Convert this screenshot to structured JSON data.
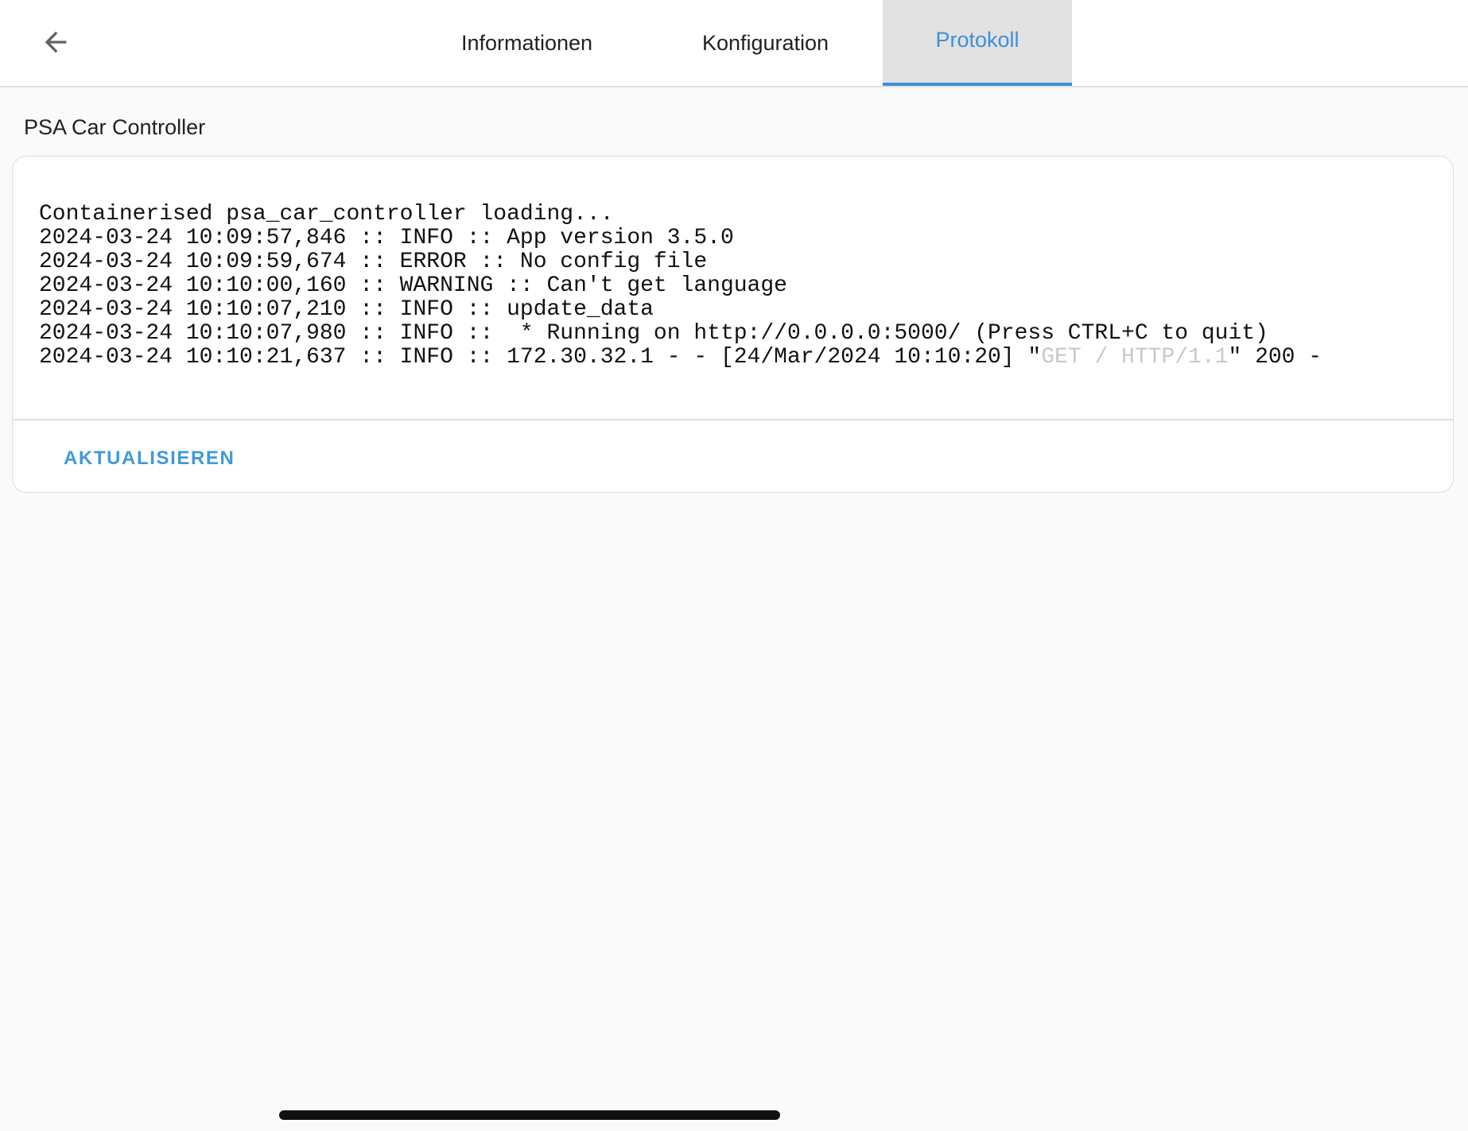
{
  "header": {
    "back_icon": "arrow-left-icon",
    "tabs": [
      {
        "label": "Informationen",
        "active": false
      },
      {
        "label": "Konfiguration",
        "active": false
      },
      {
        "label": "Protokoll",
        "active": true
      }
    ]
  },
  "addon": {
    "name": "PSA Car Controller"
  },
  "log": {
    "lines": [
      "Containerised psa_car_controller loading...",
      "2024-03-24 10:09:57,846 :: INFO :: App version 3.5.0",
      "2024-03-24 10:09:59,674 :: ERROR :: No config file",
      "2024-03-24 10:10:00,160 :: WARNING :: Can't get language",
      "2024-03-24 10:10:07,210 :: INFO :: update_data",
      "2024-03-24 10:10:07,980 :: INFO ::  * Running on http://0.0.0.0:5000/ (Press CTRL+C to quit)"
    ],
    "last_line": {
      "prefix": "2024-03-24 10:10:21,637 :: INFO :: 172.30.32.1 - - [24/Mar/2024 10:10:20] \"",
      "request": "GET / HTTP/1.1",
      "suffix": "\" 200 -"
    }
  },
  "actions": {
    "refresh_label": "AKTUALISIEREN"
  },
  "colors": {
    "accent": "#3f8fd8",
    "active_tab_bg": "#e1e1e1",
    "background": "#fafafa",
    "card": "#ffffff",
    "dim_text": "#c8c8c8"
  }
}
